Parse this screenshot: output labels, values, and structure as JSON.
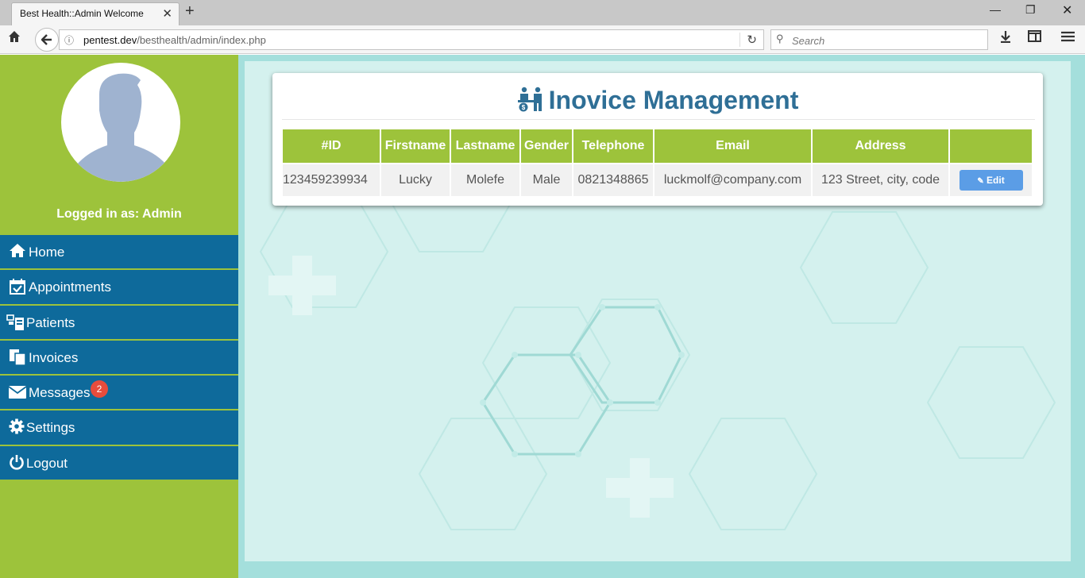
{
  "browser": {
    "tab_title": "Best Health::Admin Welcome",
    "tab_close": "✕",
    "new_tab": "+",
    "url_host": "pentest.dev",
    "url_path": "/besthealth/admin/index.php",
    "search_placeholder": "Search"
  },
  "sidebar": {
    "logged_in": "Logged in as: Admin",
    "items": [
      {
        "label": "Home",
        "icon": "home-icon"
      },
      {
        "label": "Appointments",
        "icon": "calendar-check-icon"
      },
      {
        "label": "Patients",
        "icon": "patients-icon"
      },
      {
        "label": "Invoices",
        "icon": "copy-icon"
      },
      {
        "label": "Messages",
        "icon": "envelope-icon",
        "badge": "2"
      },
      {
        "label": "Settings",
        "icon": "gear-icon"
      },
      {
        "label": "Logout",
        "icon": "power-icon"
      }
    ]
  },
  "page": {
    "title": "Inovice Management",
    "columns": [
      "#ID",
      "Firstname",
      "Lastname",
      "Gender",
      "Telephone",
      "Email",
      "Address",
      ""
    ],
    "rows": [
      {
        "id": "123459239934",
        "firstname": "Lucky",
        "lastname": "Molefe",
        "gender": "Male",
        "telephone": "0821348865",
        "email": "luckmolf@company.com",
        "address": "123 Street, city, code",
        "action": "Edit"
      }
    ]
  },
  "colors": {
    "sidebar_green": "#9dc33b",
    "menu_blue": "#0e6a9b",
    "title_blue": "#2f6f96",
    "edit_blue": "#5b9de6",
    "badge_red": "#e74c3c"
  }
}
